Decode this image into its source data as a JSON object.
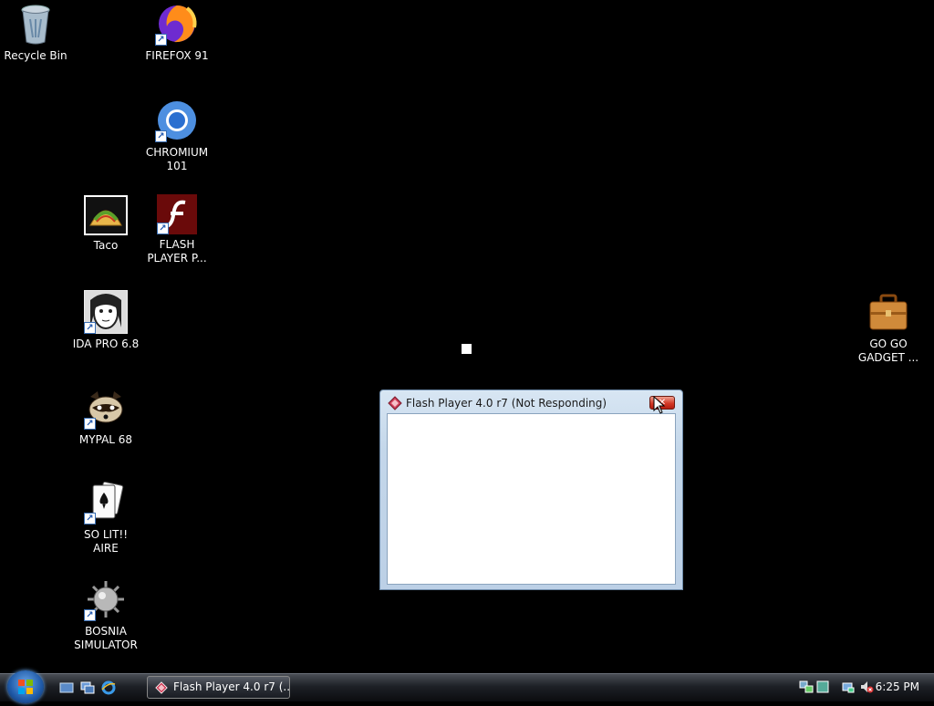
{
  "desktop": {
    "icons": [
      {
        "label": "Recycle Bin"
      },
      {
        "label": "FIREFOX 91"
      },
      {
        "label": "CHROMIUM 101"
      },
      {
        "label": "Taco"
      },
      {
        "label": "FLASH PLAYER P..."
      },
      {
        "label": "IDA PRO 6.8"
      },
      {
        "label": "MYPAL 68"
      },
      {
        "label": "SO LIT!! AIRE"
      },
      {
        "label": "BOSNIA SIMULATOR"
      },
      {
        "label": "GO GO GADGET ..."
      }
    ]
  },
  "window": {
    "title": "Flash Player 4.0 r7 (Not Responding)",
    "close_glyph": "✕"
  },
  "taskbar": {
    "task_label": "Flash Player 4.0 r7 (...",
    "clock": "6:25 PM"
  }
}
